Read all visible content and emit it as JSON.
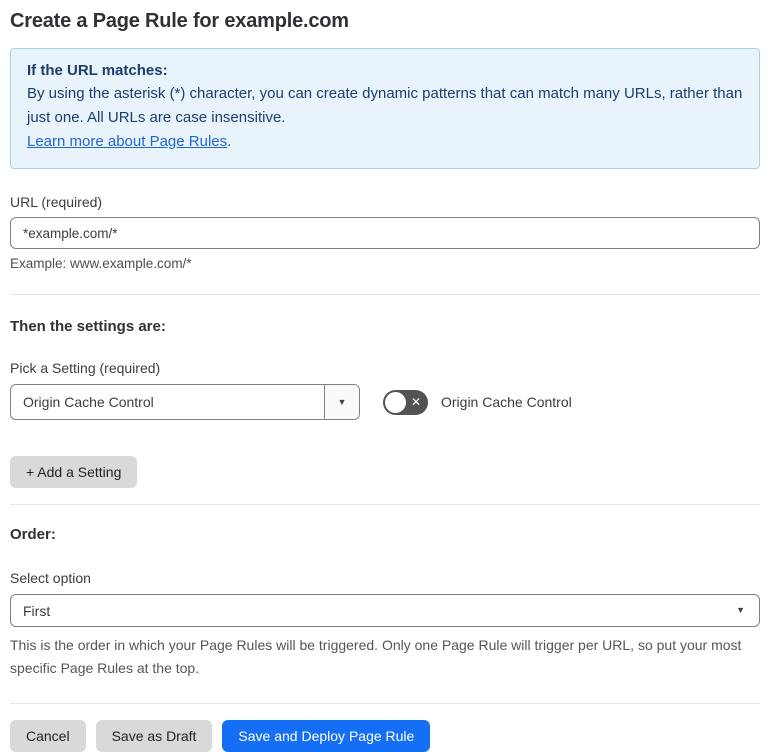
{
  "page": {
    "title": "Create a Page Rule for example.com"
  },
  "info_box": {
    "heading": "If the URL matches:",
    "body": "By using the asterisk (*) character, you can create dynamic patterns that can match many URLs, rather than just one. All URLs are case insensitive.",
    "link_label": "Learn more about Page Rules",
    "link_suffix": "."
  },
  "url_field": {
    "label": "URL (required)",
    "value": "*example.com/*",
    "helper": "Example: www.example.com/*"
  },
  "settings_section": {
    "heading": "Then the settings are:",
    "picker_label": "Pick a Setting (required)",
    "picker_value": "Origin Cache Control",
    "toggle_label": "Origin Cache Control",
    "toggle_state": "off",
    "add_setting_button": "+ Add a Setting"
  },
  "order_section": {
    "heading": "Order:",
    "label": "Select option",
    "value": "First",
    "helper": "This is the order in which your Page Rules will be triggered. Only one Page Rule will trigger per URL, so put your most specific Page Rules at the top."
  },
  "footer": {
    "cancel_button": "Cancel",
    "save_draft_button": "Save as Draft",
    "save_deploy_button": "Save and Deploy Page Rule"
  },
  "icons": {
    "caret_down": "▼",
    "toggle_off_x": "✕"
  },
  "colors": {
    "info_box_bg": "#e9f3fc",
    "info_box_border": "#a9cef2",
    "info_text": "#1d3d6f",
    "link_blue": "#2166d1",
    "primary_button_blue": "#156ff5",
    "gray_button_bg": "#d9d9d9",
    "toggle_off_bg": "#515457",
    "divider": "#e3e4e5"
  }
}
